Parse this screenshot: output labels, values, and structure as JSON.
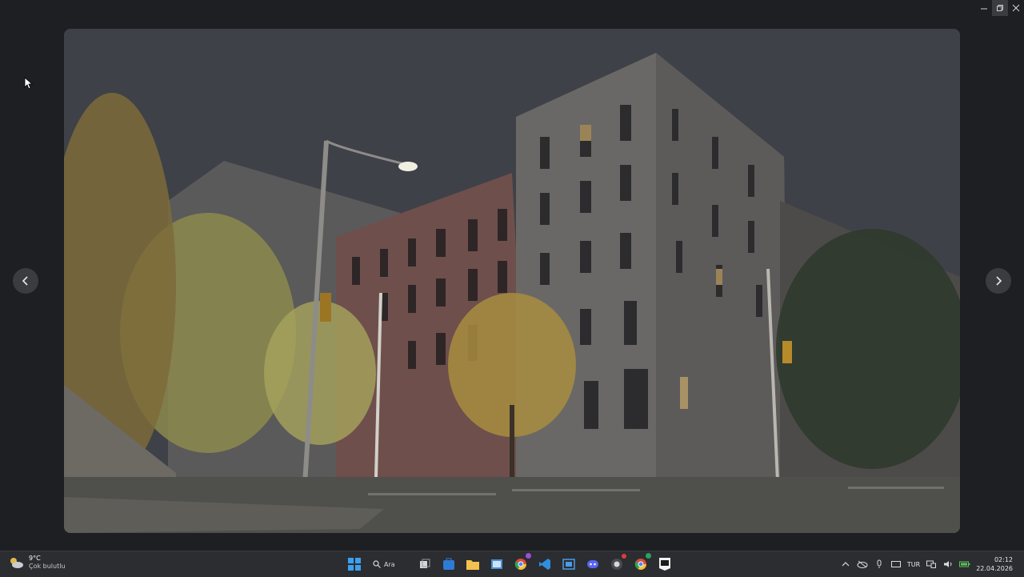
{
  "window": {
    "controls": [
      "minimize",
      "restore",
      "close"
    ]
  },
  "viewer": {
    "prev_icon": "chevron-left-icon",
    "next_icon": "chevron-right-icon",
    "photo": "night street corner with brick apartment buildings, street lamp and autumn trees"
  },
  "taskbar": {
    "weather": {
      "temp": "9°C",
      "desc": "Çok bulutlu"
    },
    "search_label": "Ara",
    "apps": [
      "start-icon",
      "search-icon",
      "file-explorer-icon",
      "store-icon",
      "folder-icon",
      "window-icon",
      "chrome-icon",
      "vscode-icon",
      "notepad-icon",
      "discord-icon",
      "github-icon",
      "chrome-alt-icon",
      "epic-games-icon"
    ],
    "tray": {
      "language": "TUR",
      "time": "02:12",
      "date": "22.04.2026"
    }
  }
}
